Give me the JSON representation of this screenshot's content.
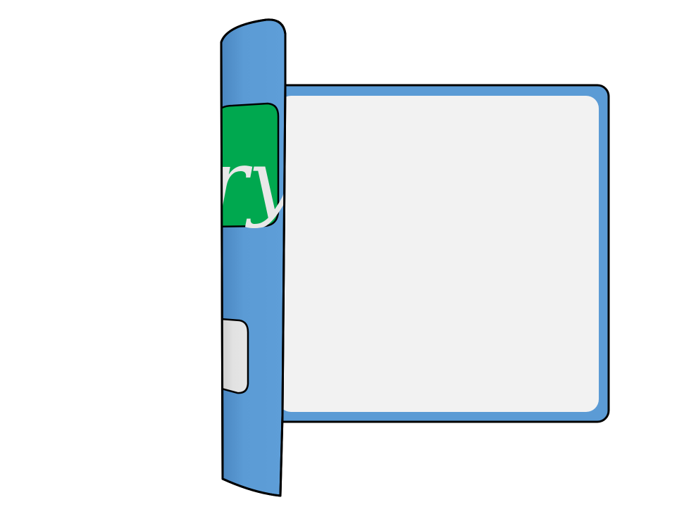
{
  "illustration": {
    "label_text": "ry"
  },
  "colors": {
    "background": "#ffffff",
    "panel_frame": "#5b9bd5",
    "panel_inner": "#f2f2f2",
    "outline": "#000000",
    "cover_light": "#5b9bd5",
    "cover_shadow": "#4a86c0",
    "label_green": "#00a84f",
    "label_text": "#e8e8e8",
    "tab_grey_light": "#e6e6e6",
    "tab_grey_dark": "#bdbdbd"
  }
}
